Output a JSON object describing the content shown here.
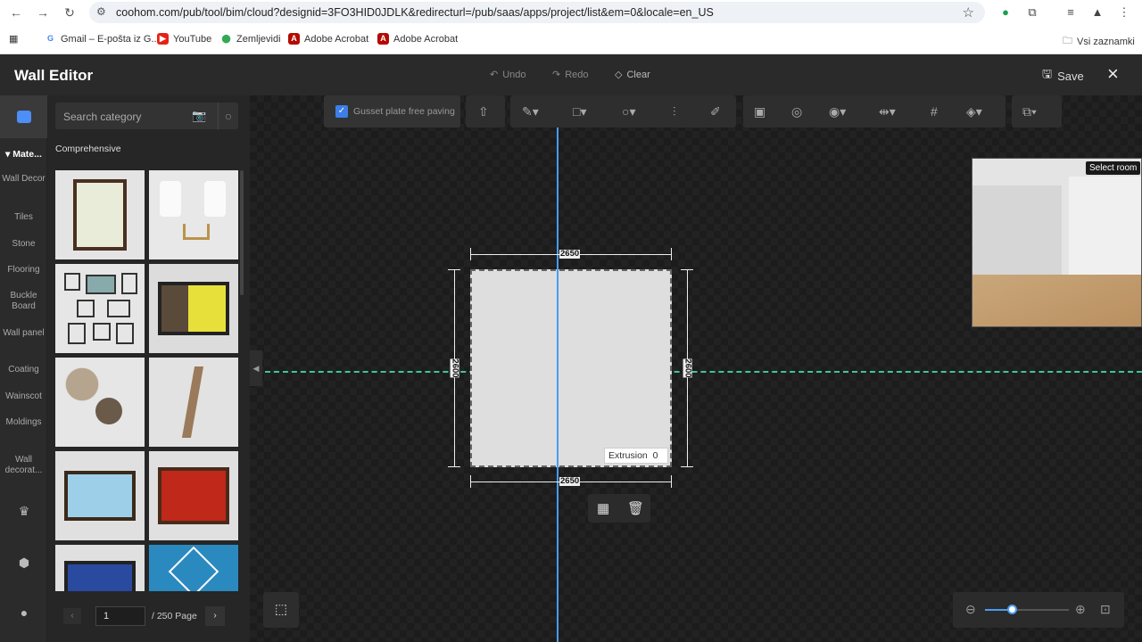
{
  "browser": {
    "url": "coohom.com/pub/tool/bim/cloud?designid=3FO3HID0JDLK&redirecturl=/pub/saas/apps/project/list&em=0&locale=en_US",
    "bookmarks": [
      "Gmail – E-pošta iz G...",
      "YouTube",
      "Zemljevidi",
      "Adobe Acrobat",
      "Adobe Acrobat"
    ],
    "all_bookmarks": "Vsi zaznamki"
  },
  "header": {
    "title": "Wall Editor",
    "undo": "Undo",
    "redo": "Redo",
    "clear": "Clear",
    "save": "Save"
  },
  "rail": {
    "section": "Mate...",
    "items": [
      "Wall Decor",
      "Tiles",
      "Stone",
      "Flooring",
      "Buckle Board",
      "Wall panel",
      "Coating",
      "Wainscot",
      "Moldings",
      "Wall decorat..."
    ]
  },
  "panel": {
    "search_placeholder": "Search category",
    "category": "Comprehensive",
    "page": "1",
    "total": "/ 250 Page"
  },
  "toolbar": {
    "gusset_label": "Gusset plate free paving",
    "gusset_checked": true
  },
  "wall": {
    "width_top": "2650",
    "width_bottom": "2650",
    "height_left": "2600",
    "height_right": "2600",
    "extrusion_label": "Extrusion",
    "extrusion_value": "0"
  },
  "preview": {
    "select_room": "Select room"
  },
  "zoom": {
    "level": 0.33
  },
  "colors": {
    "accent": "#4a9cf0",
    "guide": "#3fc6a0",
    "checkbox": "#3d7fe8"
  }
}
